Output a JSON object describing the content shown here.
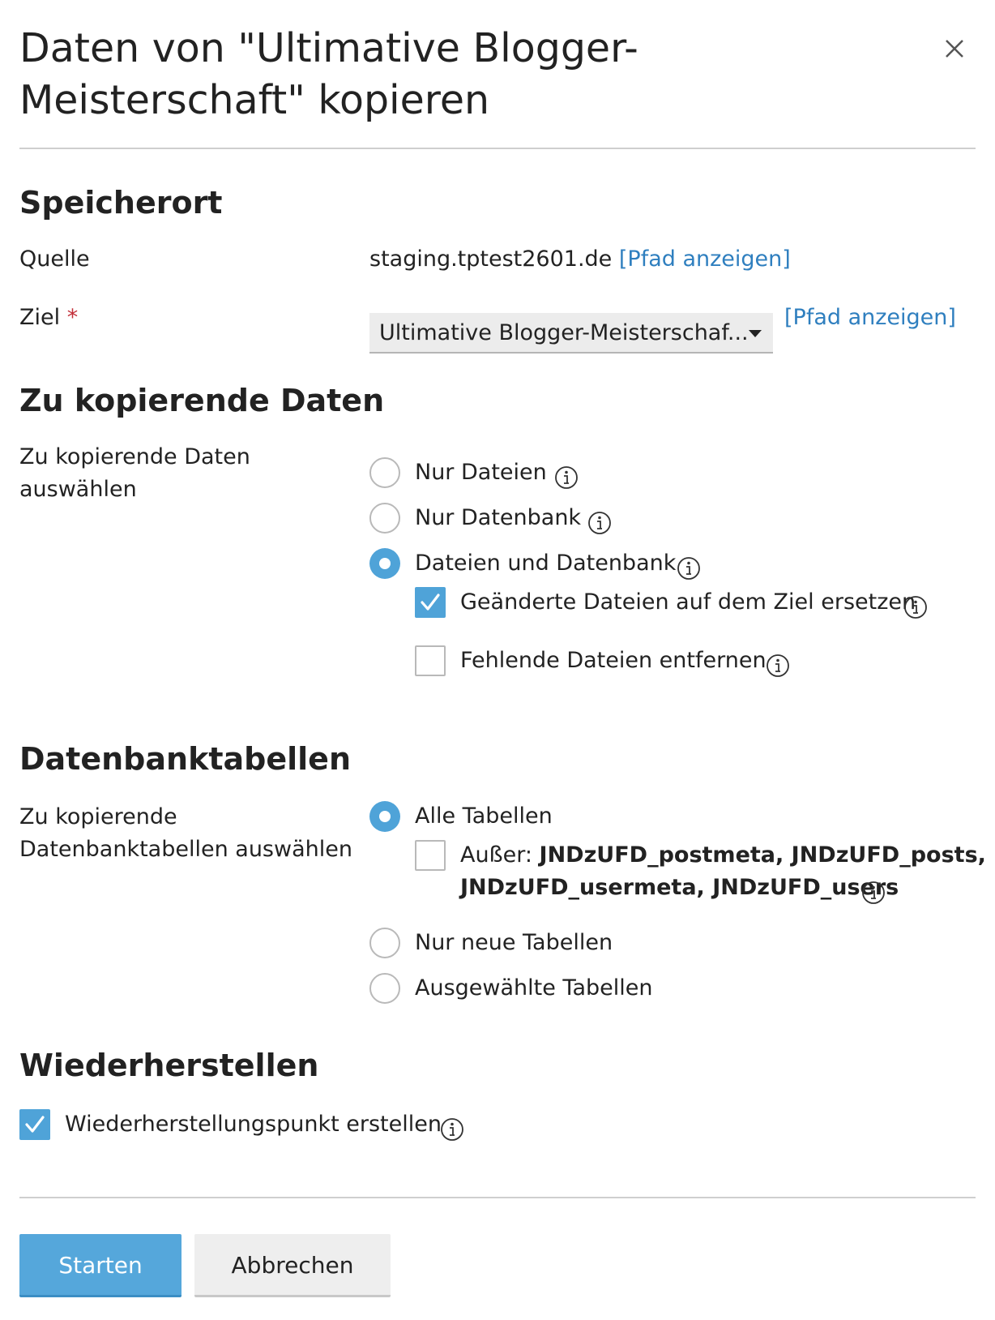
{
  "dialog": {
    "title": "Daten von \"Ultimative Blogger-Meisterschaft\" kopieren",
    "close_icon": "close-icon"
  },
  "speicherort": {
    "heading": "Speicherort",
    "source_label": "Quelle",
    "source_value": "staging.tptest2601.de",
    "source_link": "[Pfad anzeigen]",
    "target_label": "Ziel",
    "required_mark": "*",
    "target_value": "Ultimative Blogger-Meisterschaf...",
    "target_link": "[Pfad anzeigen]"
  },
  "data_section": {
    "heading": "Zu kopierende Daten",
    "label": "Zu kopierende Daten auswählen",
    "options": [
      {
        "label": "Nur Dateien",
        "selected": false
      },
      {
        "label": "Nur Datenbank",
        "selected": false
      },
      {
        "label": "Dateien und Datenbank",
        "selected": true
      }
    ],
    "suboptions": [
      {
        "label": "Geänderte Dateien auf dem Ziel ersetzen",
        "checked": true
      },
      {
        "label": "Fehlende Dateien entfernen",
        "checked": false
      }
    ]
  },
  "tables_section": {
    "heading": "Datenbanktabellen",
    "label": "Zu kopierende Datenbanktabellen auswählen",
    "options": [
      {
        "label": "Alle Tabellen",
        "selected": true
      },
      {
        "label": "Nur neue Tabellen",
        "selected": false
      },
      {
        "label": "Ausgewählte Tabellen",
        "selected": false
      }
    ],
    "except_prefix": "Außer:",
    "except_line1": "JNDzUFD_postmeta, JNDzUFD_posts,",
    "except_line2": "JNDzUFD_usermeta, JNDzUFD_users",
    "except_checked": false
  },
  "restore_section": {
    "heading": "Wiederherstellen",
    "checkbox_label": "Wiederherstellungspunkt erstellen",
    "checked": true
  },
  "buttons": {
    "start": "Starten",
    "cancel": "Abbrechen"
  },
  "colors": {
    "accent": "#4fa3d8",
    "link": "#2f7fbf",
    "required": "#c3303a"
  }
}
